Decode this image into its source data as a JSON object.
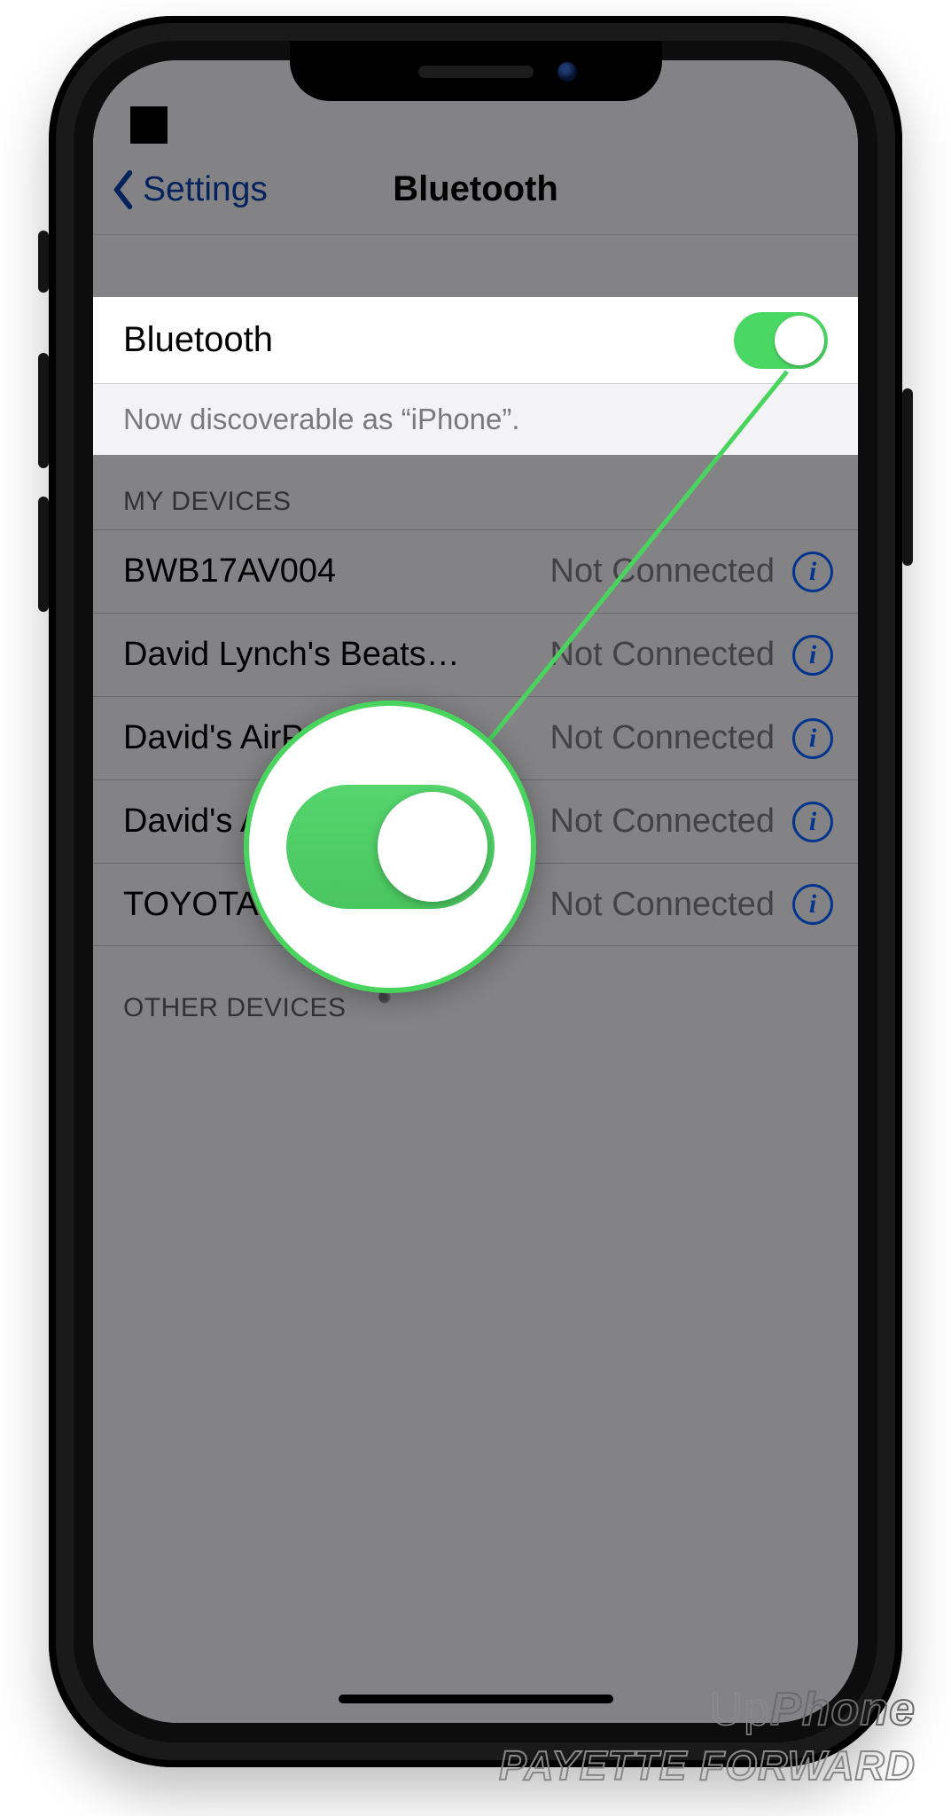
{
  "nav": {
    "back_label": "Settings",
    "title": "Bluetooth"
  },
  "bluetooth_row": {
    "label": "Bluetooth",
    "enabled": true
  },
  "discoverable_text": "Now discoverable as “iPhone”.",
  "my_devices_header": "MY DEVICES",
  "status_not_connected": "Not Connected",
  "devices": [
    {
      "name": "BWB17AV004",
      "status": "Not Connected"
    },
    {
      "name": "David Lynch's Beats S...",
      "status": "Not Connected"
    },
    {
      "name": "David's AirPods",
      "status": "Not Connected"
    },
    {
      "name": "David's Apple Watch",
      "status": "Not Connected"
    },
    {
      "name": "TOYOTA RAV4",
      "status": "Not Connected"
    }
  ],
  "other_devices_header": "OTHER DEVICES",
  "watermark": {
    "line1_a": "Up",
    "line1_b": "Phone",
    "line2": "PAYETTE FORWARD"
  },
  "colors": {
    "ios_green": "#4bd763",
    "ios_blue": "#0a60ff",
    "link_blue": "#0a3fa8"
  }
}
